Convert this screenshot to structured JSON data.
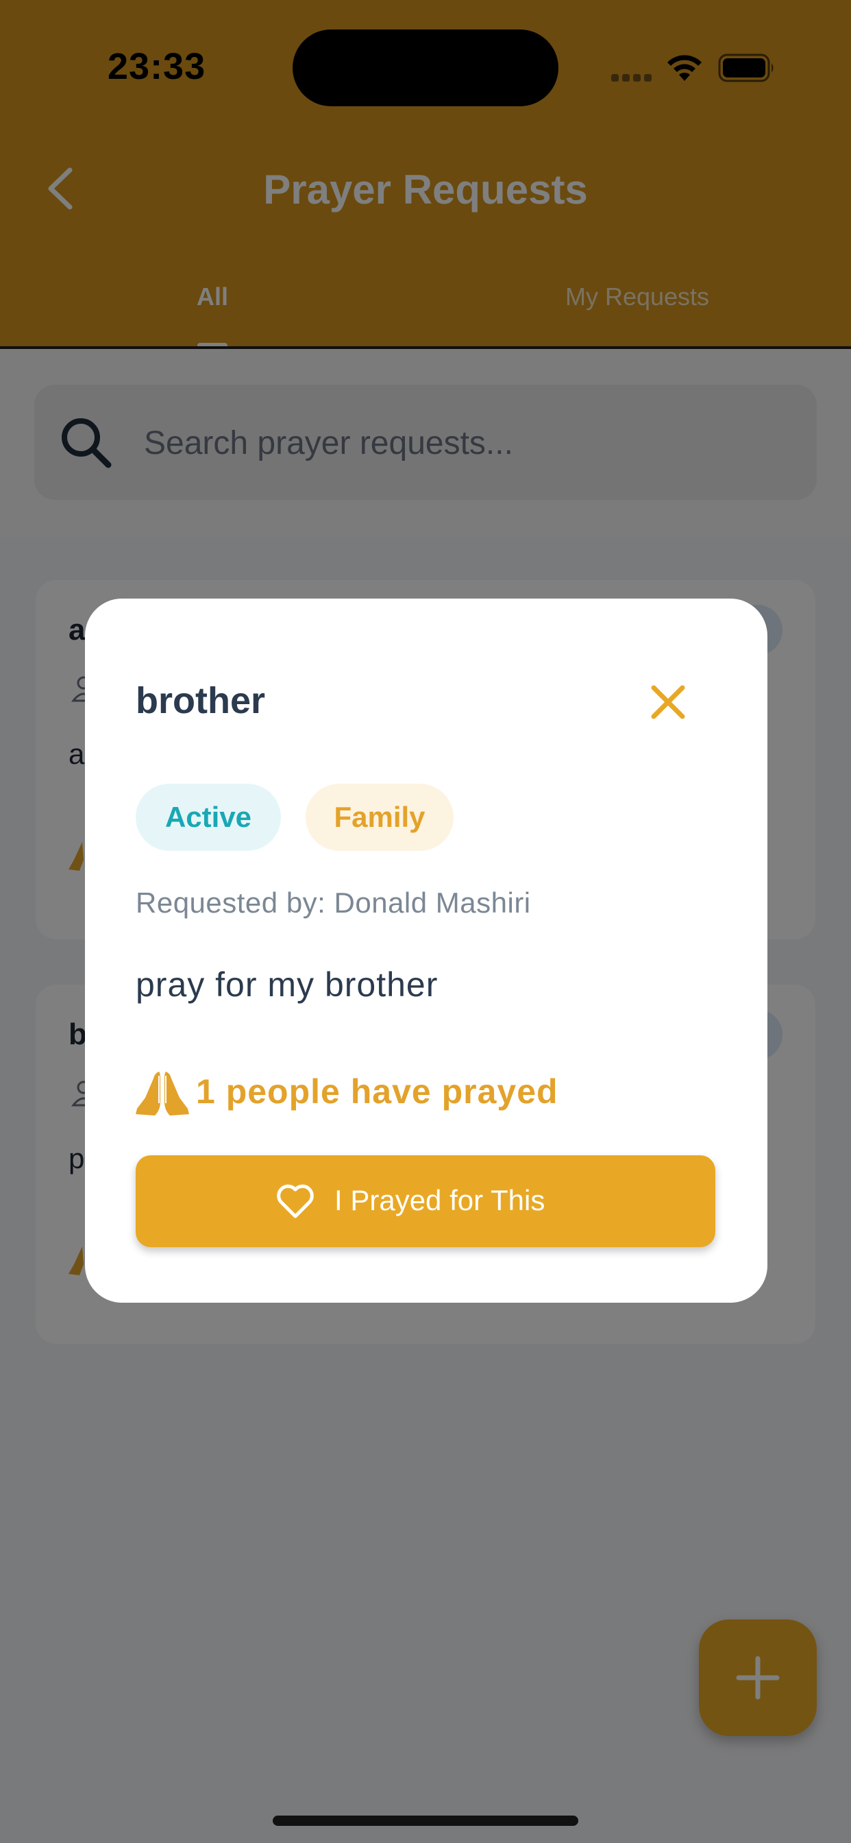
{
  "status_bar": {
    "time": "23:33"
  },
  "header": {
    "title": "Prayer Requests",
    "tabs": [
      {
        "label": "All",
        "selected": true
      },
      {
        "label": "My Requests",
        "selected": false
      }
    ]
  },
  "search": {
    "placeholder": "Search prayer requests..."
  },
  "cards": [
    {
      "title_fragment": "a",
      "body_fragment": "a"
    },
    {
      "title_fragment": "b",
      "body_fragment": "p"
    }
  ],
  "modal": {
    "title": "brother",
    "status_chip": "Active",
    "category_chip": "Family",
    "requested_by": "Requested by: Donald Mashiri",
    "message": "pray for my brother",
    "prayed_count_text": "1 people have prayed",
    "pray_button_label": "I Prayed for This"
  },
  "colors": {
    "header": "#d4951e",
    "accent": "#e8a825",
    "active_chip_text": "#1aa7b5",
    "family_chip_text": "#e3a22a"
  },
  "icons": {
    "back": "chevron-left-icon",
    "search": "search-icon",
    "close": "close-icon",
    "prayed": "praying-hands-icon",
    "heart": "heart-icon",
    "add": "plus-icon"
  }
}
